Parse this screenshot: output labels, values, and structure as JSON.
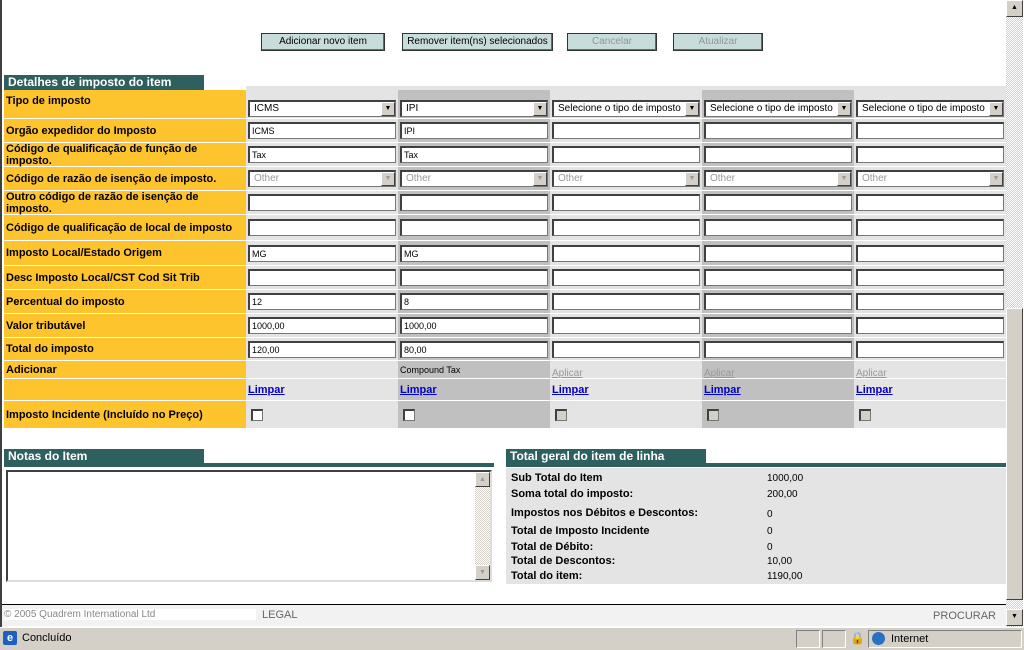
{
  "toolbar": {
    "add": "Adicionar novo item",
    "remove": "Remover item(ns) selecionados",
    "cancel": "Cancelar",
    "update": "Atualizar"
  },
  "tax_section": {
    "title": "Detalhes de imposto do item"
  },
  "tax_rows": [
    {
      "label": "Tipo de imposto",
      "type": "select",
      "values": [
        "ICMS",
        "IPI",
        "Selecione o tipo de imposto",
        "Selecione o tipo de imposto",
        "Selecione o tipo de imposto"
      ]
    },
    {
      "label": "Orgão expedidor do Imposto",
      "type": "input",
      "values": [
        "ICMS",
        "IPI",
        "",
        "",
        ""
      ]
    },
    {
      "label": "Código de qualificação de função de imposto.",
      "type": "input",
      "values": [
        "Tax",
        "Tax",
        "",
        "",
        ""
      ]
    },
    {
      "label": "Código de razão de isenção de imposto.",
      "type": "select-disabled",
      "values": [
        "Other",
        "Other",
        "Other",
        "Other",
        "Other"
      ]
    },
    {
      "label": "Outro código de razão de isenção de imposto.",
      "type": "input",
      "values": [
        "",
        "",
        "",
        "",
        ""
      ]
    },
    {
      "label": "Código de qualificação de local de imposto",
      "type": "input",
      "values": [
        "",
        "",
        "",
        "",
        ""
      ]
    },
    {
      "label": "Imposto Local/Estado Origem",
      "type": "input",
      "values": [
        "MG",
        "MG",
        "",
        "",
        ""
      ]
    },
    {
      "label": "Desc Imposto Local/CST Cod Sit Trib",
      "type": "input",
      "values": [
        "",
        "",
        "",
        "",
        ""
      ]
    },
    {
      "label": "Percentual do imposto",
      "type": "input",
      "values": [
        "12",
        "8",
        "",
        "",
        ""
      ]
    },
    {
      "label": "Valor tributável",
      "type": "input",
      "values": [
        "1000,00",
        "1000,00",
        "",
        "",
        ""
      ]
    },
    {
      "label": "Total do imposto",
      "type": "input",
      "values": [
        "120,00",
        "80,00",
        "",
        "",
        ""
      ]
    },
    {
      "label": "Adicionar",
      "type": "adicionar",
      "values": [
        "",
        "Compound Tax",
        "Aplicar",
        "Aplicar",
        "Aplicar"
      ]
    },
    {
      "label": "",
      "type": "link",
      "values": [
        "Limpar",
        "Limpar",
        "Limpar",
        "Limpar",
        "Limpar"
      ]
    },
    {
      "label": "Imposto Incidente (Incluído no Preço)",
      "type": "checkbox",
      "values": [
        false,
        false,
        false,
        false,
        false
      ],
      "enabled": [
        true,
        true,
        false,
        false,
        false
      ]
    }
  ],
  "notes": {
    "title": "Notas do Item",
    "value": ""
  },
  "totals": {
    "title": "Total geral do item de linha",
    "items": [
      {
        "label": "Sub Total do Item",
        "value": "1000,00"
      },
      {
        "label": "Soma total do imposto:",
        "value": "200,00"
      },
      {
        "label": "Impostos nos Débitos e Descontos:",
        "value": "0"
      },
      {
        "label": "Total de Imposto Incidente",
        "value": "0"
      },
      {
        "label": "Total de Débito:",
        "value": "0"
      },
      {
        "label": "Total de Descontos:",
        "value": "10,00"
      },
      {
        "label": "Total do item:",
        "value": "1190,00"
      }
    ]
  },
  "footer": {
    "copyright": "© 2005 Quadrem International Ltd",
    "legal": "LEGAL",
    "search": "PROCURAR"
  },
  "statusbar": {
    "status": "Concluído",
    "zone": "Internet"
  }
}
